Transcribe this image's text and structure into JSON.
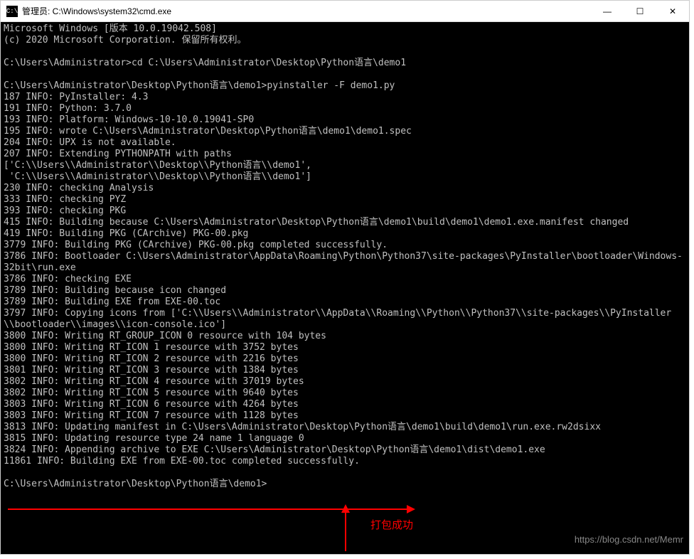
{
  "titlebar": {
    "icon_text": "C:\\",
    "title": "管理员: C:\\Windows\\system32\\cmd.exe"
  },
  "window_controls": {
    "minimize": "—",
    "maximize": "☐",
    "close": "✕"
  },
  "terminal_lines": [
    "Microsoft Windows [版本 10.0.19042.508]",
    "(c) 2020 Microsoft Corporation. 保留所有权利。",
    "",
    "C:\\Users\\Administrator>cd C:\\Users\\Administrator\\Desktop\\Python语言\\demo1",
    "",
    "C:\\Users\\Administrator\\Desktop\\Python语言\\demo1>pyinstaller -F demo1.py",
    "187 INFO: PyInstaller: 4.3",
    "191 INFO: Python: 3.7.0",
    "193 INFO: Platform: Windows-10-10.0.19041-SP0",
    "195 INFO: wrote C:\\Users\\Administrator\\Desktop\\Python语言\\demo1\\demo1.spec",
    "204 INFO: UPX is not available.",
    "207 INFO: Extending PYTHONPATH with paths",
    "['C:\\\\Users\\\\Administrator\\\\Desktop\\\\Python语言\\\\demo1',",
    " 'C:\\\\Users\\\\Administrator\\\\Desktop\\\\Python语言\\\\demo1']",
    "230 INFO: checking Analysis",
    "333 INFO: checking PYZ",
    "393 INFO: checking PKG",
    "415 INFO: Building because C:\\Users\\Administrator\\Desktop\\Python语言\\demo1\\build\\demo1\\demo1.exe.manifest changed",
    "419 INFO: Building PKG (CArchive) PKG-00.pkg",
    "3779 INFO: Building PKG (CArchive) PKG-00.pkg completed successfully.",
    "3786 INFO: Bootloader C:\\Users\\Administrator\\AppData\\Roaming\\Python\\Python37\\site-packages\\PyInstaller\\bootloader\\Windows-32bit\\run.exe",
    "3786 INFO: checking EXE",
    "3789 INFO: Building because icon changed",
    "3789 INFO: Building EXE from EXE-00.toc",
    "3797 INFO: Copying icons from ['C:\\\\Users\\\\Administrator\\\\AppData\\\\Roaming\\\\Python\\\\Python37\\\\site-packages\\\\PyInstaller\\\\bootloader\\\\images\\\\icon-console.ico']",
    "3800 INFO: Writing RT_GROUP_ICON 0 resource with 104 bytes",
    "3800 INFO: Writing RT_ICON 1 resource with 3752 bytes",
    "3800 INFO: Writing RT_ICON 2 resource with 2216 bytes",
    "3801 INFO: Writing RT_ICON 3 resource with 1384 bytes",
    "3802 INFO: Writing RT_ICON 4 resource with 37019 bytes",
    "3802 INFO: Writing RT_ICON 5 resource with 9640 bytes",
    "3803 INFO: Writing RT_ICON 6 resource with 4264 bytes",
    "3803 INFO: Writing RT_ICON 7 resource with 1128 bytes",
    "3813 INFO: Updating manifest in C:\\Users\\Administrator\\Desktop\\Python语言\\demo1\\build\\demo1\\run.exe.rw2dsixx",
    "3815 INFO: Updating resource type 24 name 1 language 0",
    "3824 INFO: Appending archive to EXE C:\\Users\\Administrator\\Desktop\\Python语言\\demo1\\dist\\demo1.exe",
    "11861 INFO: Building EXE from EXE-00.toc completed successfully.",
    "",
    "C:\\Users\\Administrator\\Desktop\\Python语言\\demo1>"
  ],
  "annotation": {
    "label": "打包成功"
  },
  "watermark": "https://blog.csdn.net/Memr"
}
